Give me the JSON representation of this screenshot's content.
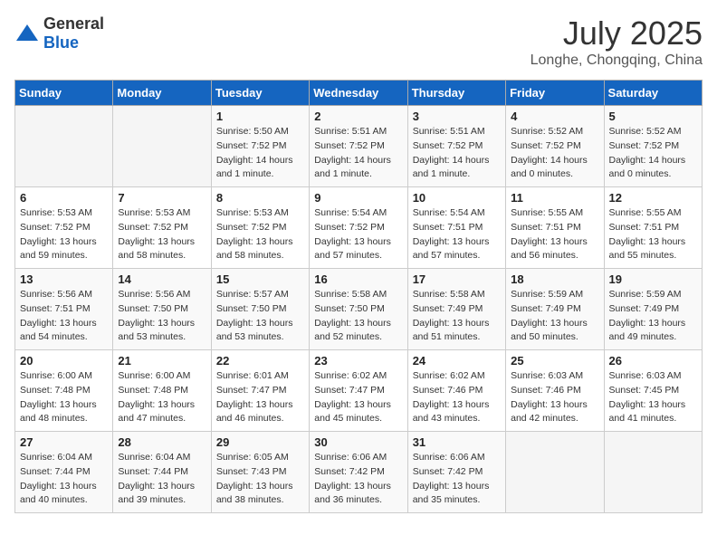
{
  "header": {
    "logo_general": "General",
    "logo_blue": "Blue",
    "month_title": "July 2025",
    "location": "Longhe, Chongqing, China"
  },
  "weekdays": [
    "Sunday",
    "Monday",
    "Tuesday",
    "Wednesday",
    "Thursday",
    "Friday",
    "Saturday"
  ],
  "weeks": [
    [
      {
        "day": "",
        "info": ""
      },
      {
        "day": "",
        "info": ""
      },
      {
        "day": "1",
        "info": "Sunrise: 5:50 AM\nSunset: 7:52 PM\nDaylight: 14 hours\nand 1 minute."
      },
      {
        "day": "2",
        "info": "Sunrise: 5:51 AM\nSunset: 7:52 PM\nDaylight: 14 hours\nand 1 minute."
      },
      {
        "day": "3",
        "info": "Sunrise: 5:51 AM\nSunset: 7:52 PM\nDaylight: 14 hours\nand 1 minute."
      },
      {
        "day": "4",
        "info": "Sunrise: 5:52 AM\nSunset: 7:52 PM\nDaylight: 14 hours\nand 0 minutes."
      },
      {
        "day": "5",
        "info": "Sunrise: 5:52 AM\nSunset: 7:52 PM\nDaylight: 14 hours\nand 0 minutes."
      }
    ],
    [
      {
        "day": "6",
        "info": "Sunrise: 5:53 AM\nSunset: 7:52 PM\nDaylight: 13 hours\nand 59 minutes."
      },
      {
        "day": "7",
        "info": "Sunrise: 5:53 AM\nSunset: 7:52 PM\nDaylight: 13 hours\nand 58 minutes."
      },
      {
        "day": "8",
        "info": "Sunrise: 5:53 AM\nSunset: 7:52 PM\nDaylight: 13 hours\nand 58 minutes."
      },
      {
        "day": "9",
        "info": "Sunrise: 5:54 AM\nSunset: 7:52 PM\nDaylight: 13 hours\nand 57 minutes."
      },
      {
        "day": "10",
        "info": "Sunrise: 5:54 AM\nSunset: 7:51 PM\nDaylight: 13 hours\nand 57 minutes."
      },
      {
        "day": "11",
        "info": "Sunrise: 5:55 AM\nSunset: 7:51 PM\nDaylight: 13 hours\nand 56 minutes."
      },
      {
        "day": "12",
        "info": "Sunrise: 5:55 AM\nSunset: 7:51 PM\nDaylight: 13 hours\nand 55 minutes."
      }
    ],
    [
      {
        "day": "13",
        "info": "Sunrise: 5:56 AM\nSunset: 7:51 PM\nDaylight: 13 hours\nand 54 minutes."
      },
      {
        "day": "14",
        "info": "Sunrise: 5:56 AM\nSunset: 7:50 PM\nDaylight: 13 hours\nand 53 minutes."
      },
      {
        "day": "15",
        "info": "Sunrise: 5:57 AM\nSunset: 7:50 PM\nDaylight: 13 hours\nand 53 minutes."
      },
      {
        "day": "16",
        "info": "Sunrise: 5:58 AM\nSunset: 7:50 PM\nDaylight: 13 hours\nand 52 minutes."
      },
      {
        "day": "17",
        "info": "Sunrise: 5:58 AM\nSunset: 7:49 PM\nDaylight: 13 hours\nand 51 minutes."
      },
      {
        "day": "18",
        "info": "Sunrise: 5:59 AM\nSunset: 7:49 PM\nDaylight: 13 hours\nand 50 minutes."
      },
      {
        "day": "19",
        "info": "Sunrise: 5:59 AM\nSunset: 7:49 PM\nDaylight: 13 hours\nand 49 minutes."
      }
    ],
    [
      {
        "day": "20",
        "info": "Sunrise: 6:00 AM\nSunset: 7:48 PM\nDaylight: 13 hours\nand 48 minutes."
      },
      {
        "day": "21",
        "info": "Sunrise: 6:00 AM\nSunset: 7:48 PM\nDaylight: 13 hours\nand 47 minutes."
      },
      {
        "day": "22",
        "info": "Sunrise: 6:01 AM\nSunset: 7:47 PM\nDaylight: 13 hours\nand 46 minutes."
      },
      {
        "day": "23",
        "info": "Sunrise: 6:02 AM\nSunset: 7:47 PM\nDaylight: 13 hours\nand 45 minutes."
      },
      {
        "day": "24",
        "info": "Sunrise: 6:02 AM\nSunset: 7:46 PM\nDaylight: 13 hours\nand 43 minutes."
      },
      {
        "day": "25",
        "info": "Sunrise: 6:03 AM\nSunset: 7:46 PM\nDaylight: 13 hours\nand 42 minutes."
      },
      {
        "day": "26",
        "info": "Sunrise: 6:03 AM\nSunset: 7:45 PM\nDaylight: 13 hours\nand 41 minutes."
      }
    ],
    [
      {
        "day": "27",
        "info": "Sunrise: 6:04 AM\nSunset: 7:44 PM\nDaylight: 13 hours\nand 40 minutes."
      },
      {
        "day": "28",
        "info": "Sunrise: 6:04 AM\nSunset: 7:44 PM\nDaylight: 13 hours\nand 39 minutes."
      },
      {
        "day": "29",
        "info": "Sunrise: 6:05 AM\nSunset: 7:43 PM\nDaylight: 13 hours\nand 38 minutes."
      },
      {
        "day": "30",
        "info": "Sunrise: 6:06 AM\nSunset: 7:42 PM\nDaylight: 13 hours\nand 36 minutes."
      },
      {
        "day": "31",
        "info": "Sunrise: 6:06 AM\nSunset: 7:42 PM\nDaylight: 13 hours\nand 35 minutes."
      },
      {
        "day": "",
        "info": ""
      },
      {
        "day": "",
        "info": ""
      }
    ]
  ]
}
